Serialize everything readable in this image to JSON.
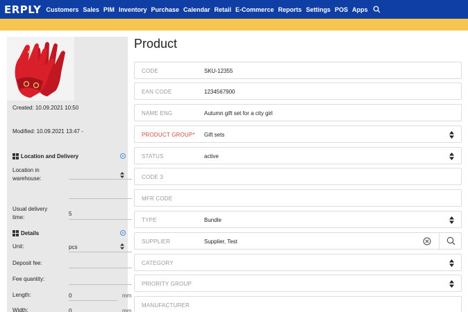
{
  "nav": {
    "logo": "ERPLY",
    "items": [
      "Customers",
      "Sales",
      "PIM",
      "Inventory",
      "Purchase",
      "Calendar",
      "Retail",
      "E-Commerce",
      "Reports",
      "Settings",
      "POS",
      "Apps"
    ]
  },
  "left": {
    "created": "Created: 10.09.2021 10:50",
    "modified": "Modified: 10.09.2021 13:47 -",
    "location_section": "Location and Delivery",
    "location_label_1": "Location in",
    "location_label_2": "warehouse:",
    "location_value": "",
    "delivery_label_1": "Usual delivery",
    "delivery_label_2": "time:",
    "delivery_value": "5",
    "details_section": "Details",
    "unit_label": "Unit:",
    "unit_value": "pcs",
    "deposit_label": "Deposit fee:",
    "deposit_value": "",
    "fee_qty_label": "Fee quantity:",
    "fee_qty_value": "",
    "length_label": "Length:",
    "length_value": "0",
    "length_unit": "mm",
    "width_label": "Width:",
    "width_value": "0",
    "width_unit": "mm"
  },
  "main": {
    "title": "Product",
    "fields": {
      "code": {
        "label": "CODE",
        "value": "SKU-12355"
      },
      "ean": {
        "label": "EAN CODE",
        "value": "1234567900"
      },
      "name_eng": {
        "label": "NAME ENG",
        "value": "Autumn gift set for a city girl"
      },
      "product_group": {
        "label": "PRODUCT GROUP*",
        "value": "Gift sets"
      },
      "status": {
        "label": "STATUS",
        "value": "active"
      },
      "code3": {
        "label": "CODE 3",
        "value": ""
      },
      "mfr_code": {
        "label": "MFR CODE",
        "value": ""
      },
      "type": {
        "label": "TYPE",
        "value": "Bundle"
      },
      "supplier": {
        "label": "SUPPLIER",
        "value": "Supplier, Test"
      },
      "category": {
        "label": "CATEGORY",
        "value": ""
      },
      "priority_group": {
        "label": "PRIORITY GROUP",
        "value": ""
      },
      "manufacturer": {
        "label": "MANUFACTURER",
        "value": ""
      }
    }
  },
  "colors": {
    "nav": "#0f3ea5",
    "accent_bar": "#f7c64f",
    "required_label": "#d04a3c",
    "glove": "#d81f2a"
  }
}
